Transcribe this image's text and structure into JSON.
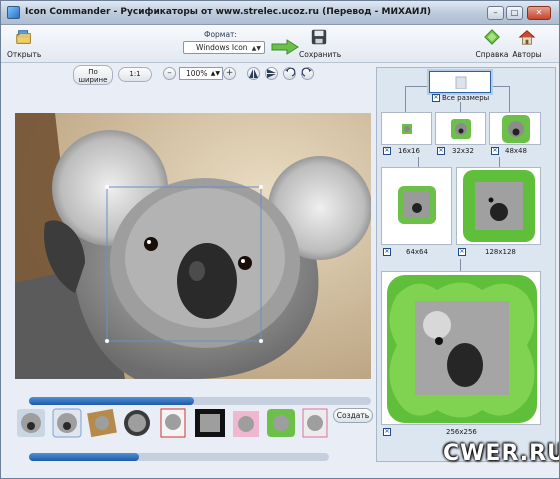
{
  "window": {
    "title": "Icon Commander  - Русификаторы от www.strelec.ucoz.ru  (Перевод - МИХАИЛ)",
    "minimize": "–",
    "maximize": "□",
    "close": "✕"
  },
  "toolbar": {
    "open_label": "Открыть",
    "format_label": "Формат:",
    "format_value": "Windows Icon",
    "save_label": "Сохранить",
    "help_label": "Справка",
    "authors_label": "Авторы"
  },
  "controls": {
    "fit_width_label": "По\nширине",
    "actual_size_label": "1:1",
    "zoom_out": "–",
    "zoom_value": "100%",
    "zoom_in": "+"
  },
  "filmstrip": {
    "create_label": "Создать",
    "thumb_count": 9
  },
  "sizes": {
    "all_label": "Все размеры",
    "items": [
      {
        "label": "16x16",
        "checked": true
      },
      {
        "label": "32x32",
        "checked": true
      },
      {
        "label": "48x48",
        "checked": true
      },
      {
        "label": "64x64",
        "checked": true
      },
      {
        "label": "128x128",
        "checked": true
      },
      {
        "label": "256x256",
        "checked": true
      }
    ]
  },
  "watermark": "CWER.RU",
  "colors": {
    "accent": "#1f5aa6",
    "leaf_green": "#5fbf3a",
    "panel_bg": "#dce6f1"
  }
}
